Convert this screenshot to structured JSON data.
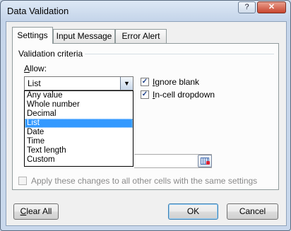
{
  "window": {
    "title": "Data Validation",
    "help_glyph": "?",
    "close_glyph": "✕"
  },
  "tabs": [
    {
      "label": "Settings",
      "active": true
    },
    {
      "label": "Input Message",
      "active": false
    },
    {
      "label": "Error Alert",
      "active": false
    }
  ],
  "settings": {
    "group_title": "Validation criteria",
    "allow_label": "Allow:",
    "allow_value": "List",
    "allow_options": [
      "Any value",
      "Whole number",
      "Decimal",
      "List",
      "Date",
      "Time",
      "Text length",
      "Custom"
    ],
    "allow_selected_index": 3,
    "ignore_blank": {
      "label": "Ignore blank",
      "checked": true
    },
    "in_cell_dropdown": {
      "label": "In-cell dropdown",
      "checked": true
    },
    "source_value": "",
    "apply_all": {
      "label": "Apply these changes to all other cells with the same settings",
      "checked": false,
      "enabled": false
    }
  },
  "buttons": {
    "clear_all": "Clear All",
    "ok": "OK",
    "cancel": "Cancel"
  },
  "icons": {
    "dropdown_arrow": "chevron-down-icon",
    "checkmark": "checkmark-icon",
    "range_select": "range-select-icon"
  }
}
